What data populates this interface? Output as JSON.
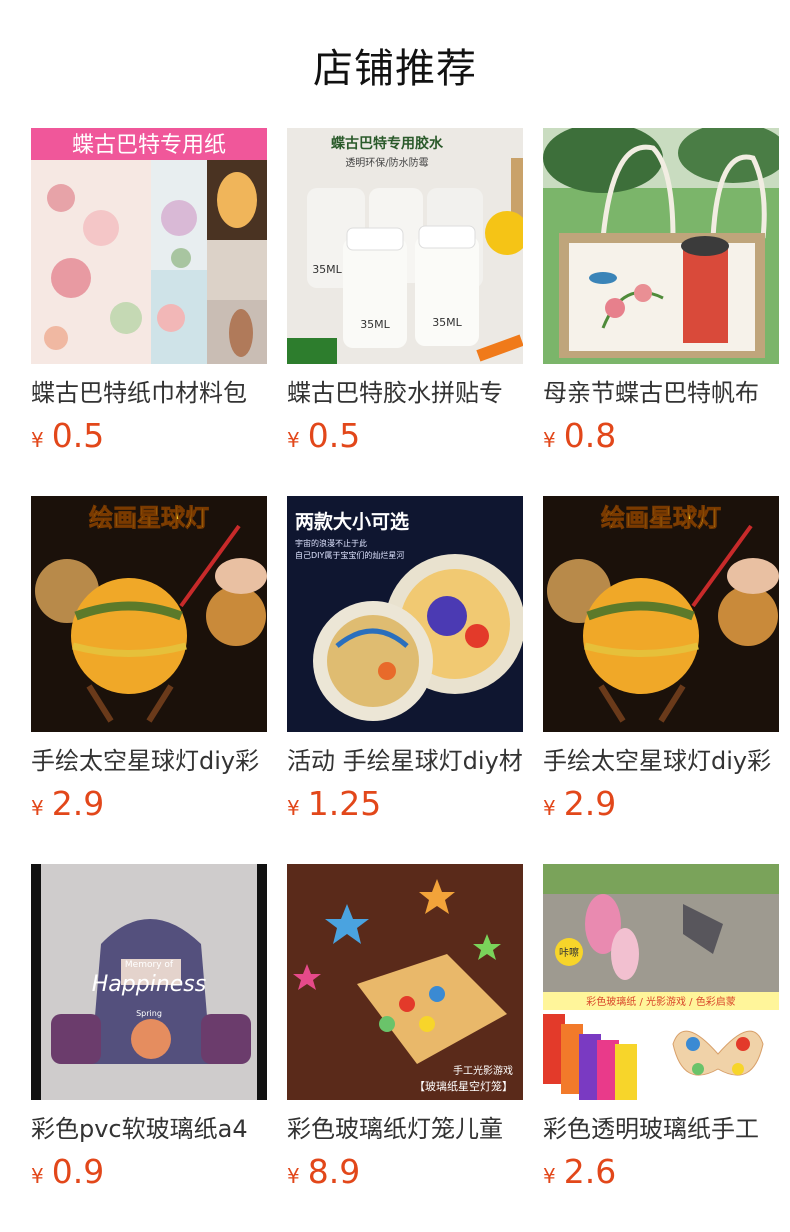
{
  "section_title": "店铺推荐",
  "currency_symbol": "¥",
  "products": [
    {
      "name": "蝶古巴特纸巾材料包",
      "price": "0.5",
      "image_text": [
        "蝶古巴特专用纸"
      ]
    },
    {
      "name": "蝶古巴特胶水拼贴专",
      "price": "0.5",
      "image_text": [
        "蝶古巴特专用胶水",
        "透明环保/防水防霉",
        "35ML",
        "35ML",
        "35ML"
      ]
    },
    {
      "name": "母亲节蝶古巴特帆布",
      "price": "0.8",
      "image_text": []
    },
    {
      "name": "手绘太空星球灯diy彩",
      "price": "2.9",
      "image_text": [
        "绘画星球灯"
      ]
    },
    {
      "name": "活动 手绘星球灯diy材",
      "price": "1.25",
      "image_text": [
        "两款大小可选",
        "宇宙的浪漫不止于此",
        "自己DIY属于宝宝们的灿烂星河"
      ]
    },
    {
      "name": "手绘太空星球灯diy彩",
      "price": "2.9",
      "image_text": [
        "绘画星球灯"
      ]
    },
    {
      "name": "彩色pvc软玻璃纸a4",
      "price": "0.9",
      "image_text": [
        "Memory of",
        "Happiness",
        "Spring"
      ]
    },
    {
      "name": "彩色玻璃纸灯笼儿童",
      "price": "8.9",
      "image_text": [
        "手工光影游戏",
        "【玻璃纸星空灯笼】"
      ]
    },
    {
      "name": "彩色透明玻璃纸手工",
      "price": "2.6",
      "image_text": [
        "咔嚓",
        "彩色玻璃纸 / 光影游戏 / 色彩启蒙"
      ]
    }
  ],
  "colors": {
    "price": "#e2471a",
    "title": "#111111",
    "name": "#333333"
  }
}
